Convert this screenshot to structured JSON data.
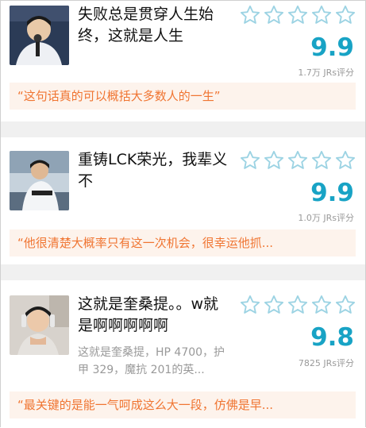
{
  "colors": {
    "accent": "#18a3c5",
    "quote_text": "#f07532",
    "quote_bg": "#fdf3ec",
    "separator": "#f0f0f0"
  },
  "rating_icon": "star-outline-icon",
  "items": [
    {
      "title_line1": "失败总是贯穿人生始",
      "title_line2": "终，这就是人生",
      "score": "9.9",
      "rating_count": "1.7万 JRs评分",
      "quote": "“这句话真的可以概括大多数人的一生”"
    },
    {
      "title_line1": "重铸LCK荣光，我辈义",
      "title_line2": "不",
      "score": "9.9",
      "rating_count": "1.0万 JRs评分",
      "quote": "“他很清楚大概率只有这一次机会，很幸运他抓..."
    },
    {
      "title_line1": "这就是奎桑提。。w就",
      "title_line2": "是啊啊啊啊啊",
      "desc_line1": "这就是奎桑提，HP 4700，护",
      "desc_line2": "甲 329，魔抗 201的英...",
      "score": "9.8",
      "rating_count": "7825 JRs评分",
      "quote": "“最关键的是能一气呵成这么大一段，仿佛是早..."
    }
  ]
}
